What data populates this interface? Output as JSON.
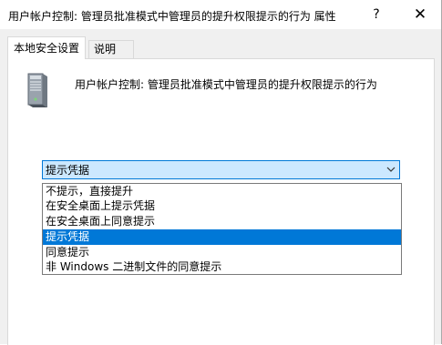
{
  "window": {
    "title": "用户帐户控制: 管理员批准模式中管理员的提升权限提示的行为 属性",
    "help_label": "?",
    "close_label": "✕"
  },
  "tabs": [
    {
      "label": "本地安全设置",
      "active": true
    },
    {
      "label": "说明",
      "active": false
    }
  ],
  "policy": {
    "icon": "computer-tower-icon",
    "name": "用户帐户控制: 管理员批准模式中管理员的提升权限提示的行为"
  },
  "combo": {
    "selected_value": "提示凭据",
    "arrow_icon": "chevron-down-icon"
  },
  "options": [
    {
      "label": "不提示，直接提升",
      "selected": false
    },
    {
      "label": "在安全桌面上提示凭据",
      "selected": false
    },
    {
      "label": "在安全桌面上同意提示",
      "selected": false
    },
    {
      "label": "提示凭据",
      "selected": true
    },
    {
      "label": "同意提示",
      "selected": false
    },
    {
      "label": "非 Windows 二进制文件的同意提示",
      "selected": false
    }
  ],
  "colors": {
    "accent": "#0078d7",
    "combo_bg": "#cce8ff",
    "window_bg": "#f0f0f0"
  }
}
